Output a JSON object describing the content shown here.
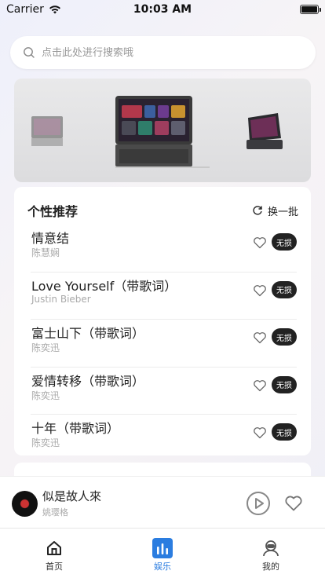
{
  "status_bar": {
    "carrier": "Carrier",
    "time": "10:03 AM"
  },
  "search": {
    "placeholder": "点击此处进行搜索哦"
  },
  "recommend": {
    "title": "个性推荐",
    "refresh_label": "换一批",
    "songs": [
      {
        "title": "情意结",
        "artist": "陈慧娴",
        "badge": "无损"
      },
      {
        "title": "Love Yourself（带歌词）",
        "artist": "Justin Bieber",
        "badge": "无损"
      },
      {
        "title": "富士山下（带歌词）",
        "artist": "陈奕迅",
        "badge": "无损"
      },
      {
        "title": "爱情转移（带歌词）",
        "artist": "陈奕迅",
        "badge": "无损"
      },
      {
        "title": "十年（带歌词）",
        "artist": "陈奕迅",
        "badge": "无损"
      }
    ]
  },
  "player": {
    "title": "似是故人來",
    "artist": "姚璎格"
  },
  "tabs": [
    {
      "label": "首页",
      "icon": "home-icon",
      "active": false
    },
    {
      "label": "娱乐",
      "icon": "bar-chart-icon",
      "active": true
    },
    {
      "label": "我的",
      "icon": "profile-icon",
      "active": false
    }
  ],
  "colors": {
    "accent": "#2b7de0",
    "badge_bg": "#222222"
  }
}
